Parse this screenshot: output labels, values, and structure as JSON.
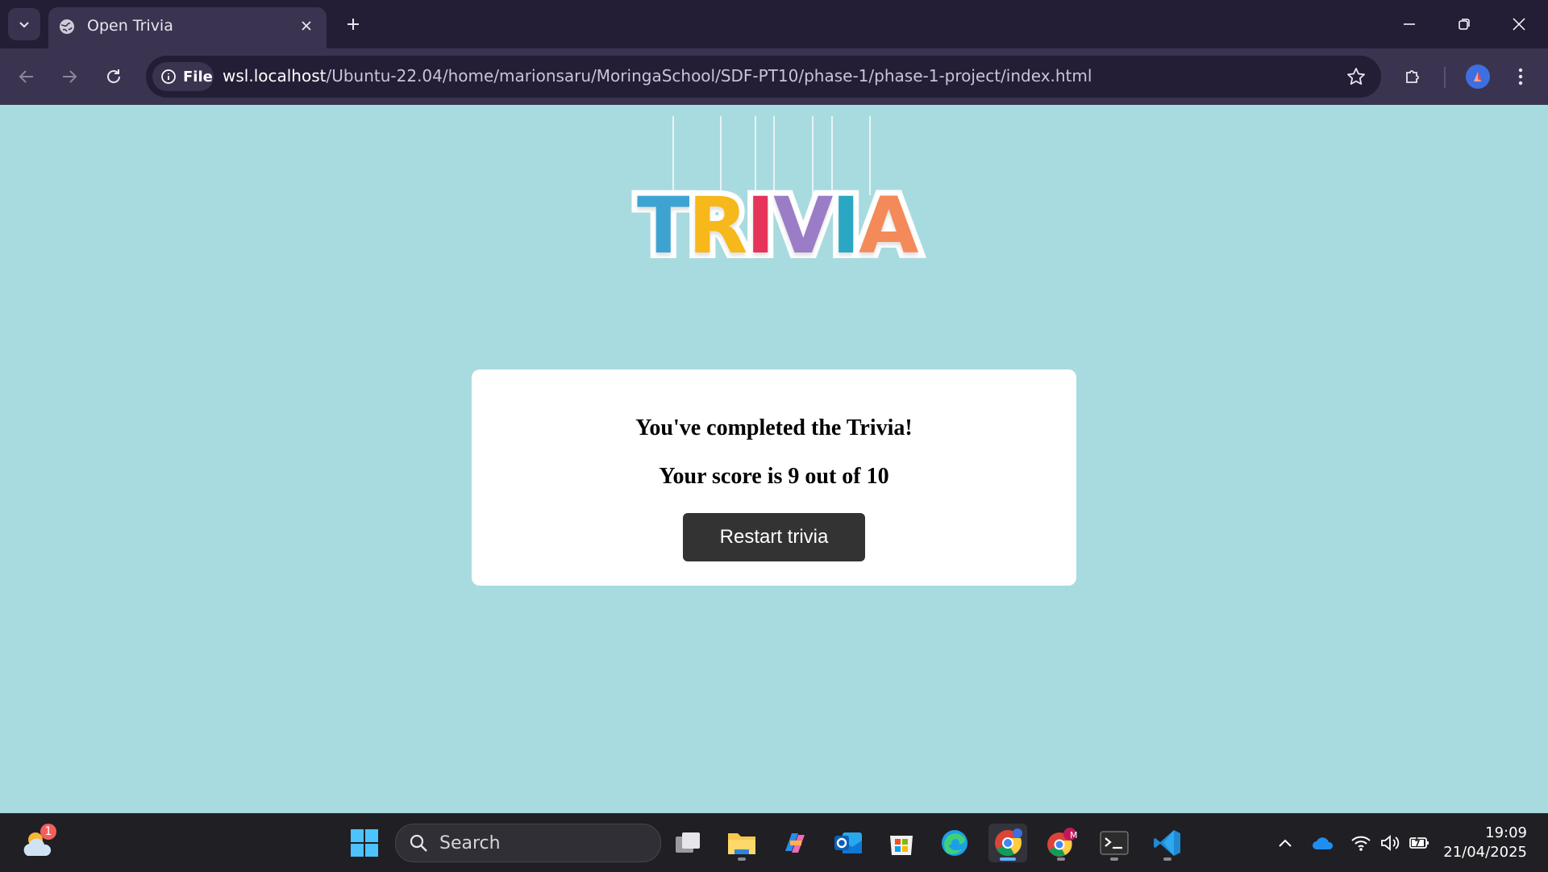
{
  "browser": {
    "tab_title": "Open Trivia",
    "url_host": "wsl.localhost",
    "url_path": "/Ubuntu-22.04/home/marionsaru/MoringaSchool/SDF-PT10/phase-1/phase-1-project/index.html",
    "site_chip_label": "File"
  },
  "page": {
    "logo_letters": [
      "T",
      "R",
      "I",
      "V",
      "I",
      "A"
    ],
    "logo_colors": [
      "#3fa3d1",
      "#f6b81a",
      "#e6335a",
      "#9a7dc6",
      "#2aa7c2",
      "#f48a5a"
    ],
    "completed_text": "You've completed the Trivia!",
    "score_text": "Your score is 9 out of 10",
    "restart_label": "Restart trivia"
  },
  "taskbar": {
    "weather_badge": "1",
    "search_label": "Search",
    "time": "19:09",
    "date": "21/04/2025",
    "apps": [
      "task-view-icon",
      "file-explorer-icon",
      "copilot-icon",
      "outlook-icon",
      "microsoft-store-icon",
      "edge-icon",
      "chrome-icon",
      "chrome-profile-icon",
      "terminal-icon",
      "vscode-icon"
    ],
    "chrome_profile_badge": "M"
  }
}
